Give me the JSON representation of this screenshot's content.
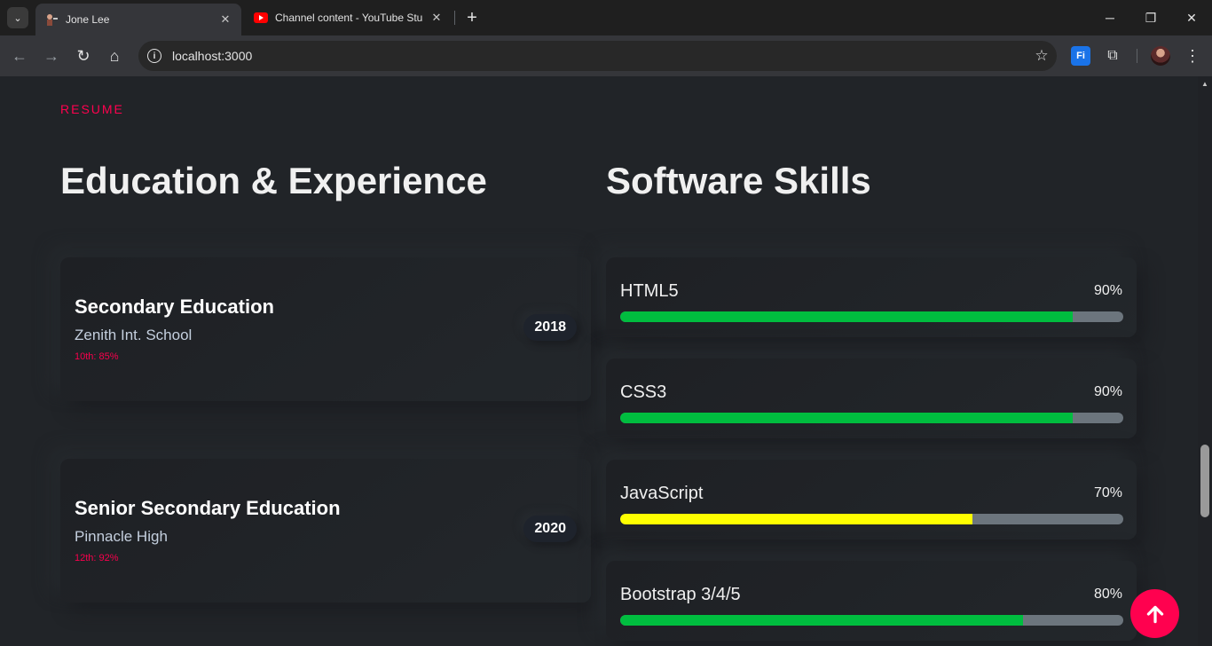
{
  "browser": {
    "tabs": [
      {
        "title": "Jone Lee",
        "active": true
      },
      {
        "title": "Channel content - YouTube Studio",
        "active": false
      }
    ],
    "url": "localhost:3000",
    "icons": {
      "tab_search": "chevron-down-icon",
      "new_tab": "plus-icon",
      "back": "arrow-left-icon",
      "forward": "arrow-right-icon",
      "reload": "reload-icon",
      "home": "home-icon",
      "site_info": "info-icon",
      "bookmark": "star-icon",
      "extension": "puzzle-icon",
      "menu": "kebab-menu-icon"
    },
    "extension_label": "Fi"
  },
  "page": {
    "eyebrow": "RESUME",
    "education_heading": "Education & Experience",
    "skills_heading": "Software Skills",
    "education": [
      {
        "title": "Secondary Education",
        "school": "Zenith Int. School",
        "score": "10th: 85%",
        "year": "2018"
      },
      {
        "title": "Senior Secondary Education",
        "school": "Pinnacle High",
        "score": "12th: 92%",
        "year": "2020"
      }
    ],
    "skills": [
      {
        "name": "HTML5",
        "percent_label": "90%",
        "value": 90,
        "color": "#00bd3f"
      },
      {
        "name": "CSS3",
        "percent_label": "90%",
        "value": 90,
        "color": "#00bd3f"
      },
      {
        "name": "JavaScript",
        "percent_label": "70%",
        "value": 70,
        "color": "#ffff00"
      },
      {
        "name": "Bootstrap 3/4/5",
        "percent_label": "80%",
        "value": 80,
        "color": "#00bd3f"
      }
    ]
  },
  "colors": {
    "accent": "#ff014f",
    "background": "#212428"
  }
}
